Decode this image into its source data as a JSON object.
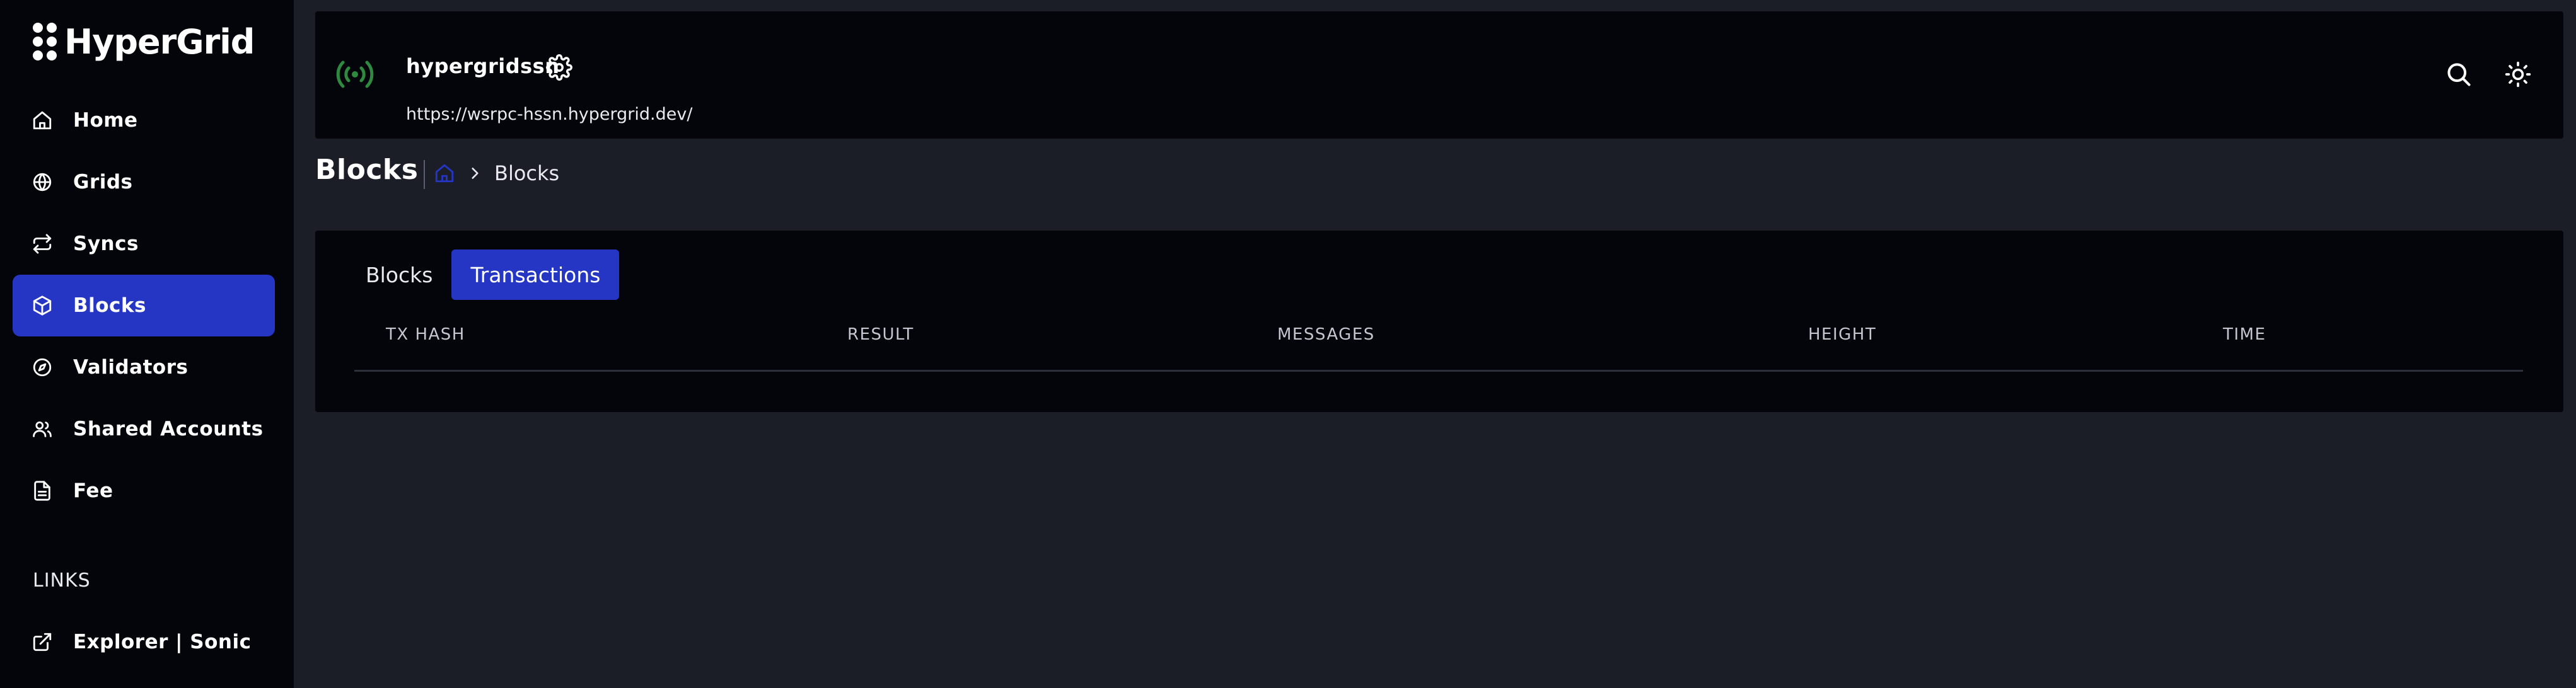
{
  "brand": {
    "name": "HyperGrid"
  },
  "sidebar": {
    "items": [
      {
        "label": "Home",
        "icon": "home-icon",
        "active": false
      },
      {
        "label": "Grids",
        "icon": "globe-icon",
        "active": false
      },
      {
        "label": "Syncs",
        "icon": "repeat-icon",
        "active": false
      },
      {
        "label": "Blocks",
        "icon": "box-icon",
        "active": true
      },
      {
        "label": "Validators",
        "icon": "compass-icon",
        "active": false
      },
      {
        "label": "Shared Accounts",
        "icon": "users-icon",
        "active": false
      },
      {
        "label": "Fee",
        "icon": "file-text-icon",
        "active": false
      }
    ],
    "links_heading": "LINKS",
    "links": [
      {
        "label": "Explorer | Sonic",
        "icon": "external-link-icon"
      }
    ]
  },
  "header": {
    "network_name": "hypergridssn",
    "network_url": "https://wsrpc-hssn.hypergrid.dev/",
    "status_icon": "broadcast-icon",
    "status_color": "#2f8a3f",
    "actions": [
      "search-icon",
      "sun-icon"
    ]
  },
  "page": {
    "title": "Blocks",
    "breadcrumb": {
      "home_icon": "home-icon",
      "current": "Blocks"
    }
  },
  "tabs": [
    {
      "label": "Blocks",
      "active": false
    },
    {
      "label": "Transactions",
      "active": true
    }
  ],
  "table": {
    "columns": [
      "TX HASH",
      "RESULT",
      "MESSAGES",
      "HEIGHT",
      "TIME"
    ],
    "rows": []
  },
  "colors": {
    "accent": "#2535c4",
    "sidebar_bg": "#03050a",
    "page_bg": "#1b1e27",
    "card_bg": "#03050a"
  }
}
